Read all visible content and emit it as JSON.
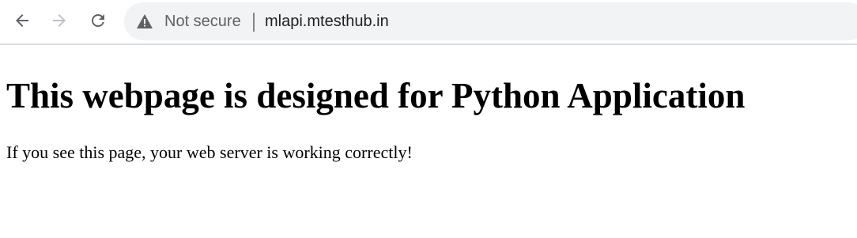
{
  "browser": {
    "back_icon": "arrow-left-icon",
    "forward_icon": "arrow-right-icon",
    "reload_icon": "reload-icon",
    "security_icon": "warning-triangle-icon",
    "security_label": "Not secure",
    "url": "mlapi.mtesthub.in"
  },
  "page": {
    "heading": "This webpage is designed for Python Application",
    "message": "If you see this page, your web server is working correctly!"
  },
  "colors": {
    "toolbar_icon": "#5f6368",
    "disabled_icon": "#bdc1c6",
    "omnibox_bg": "#f1f3f4",
    "toolbar_border": "#dadce0"
  }
}
